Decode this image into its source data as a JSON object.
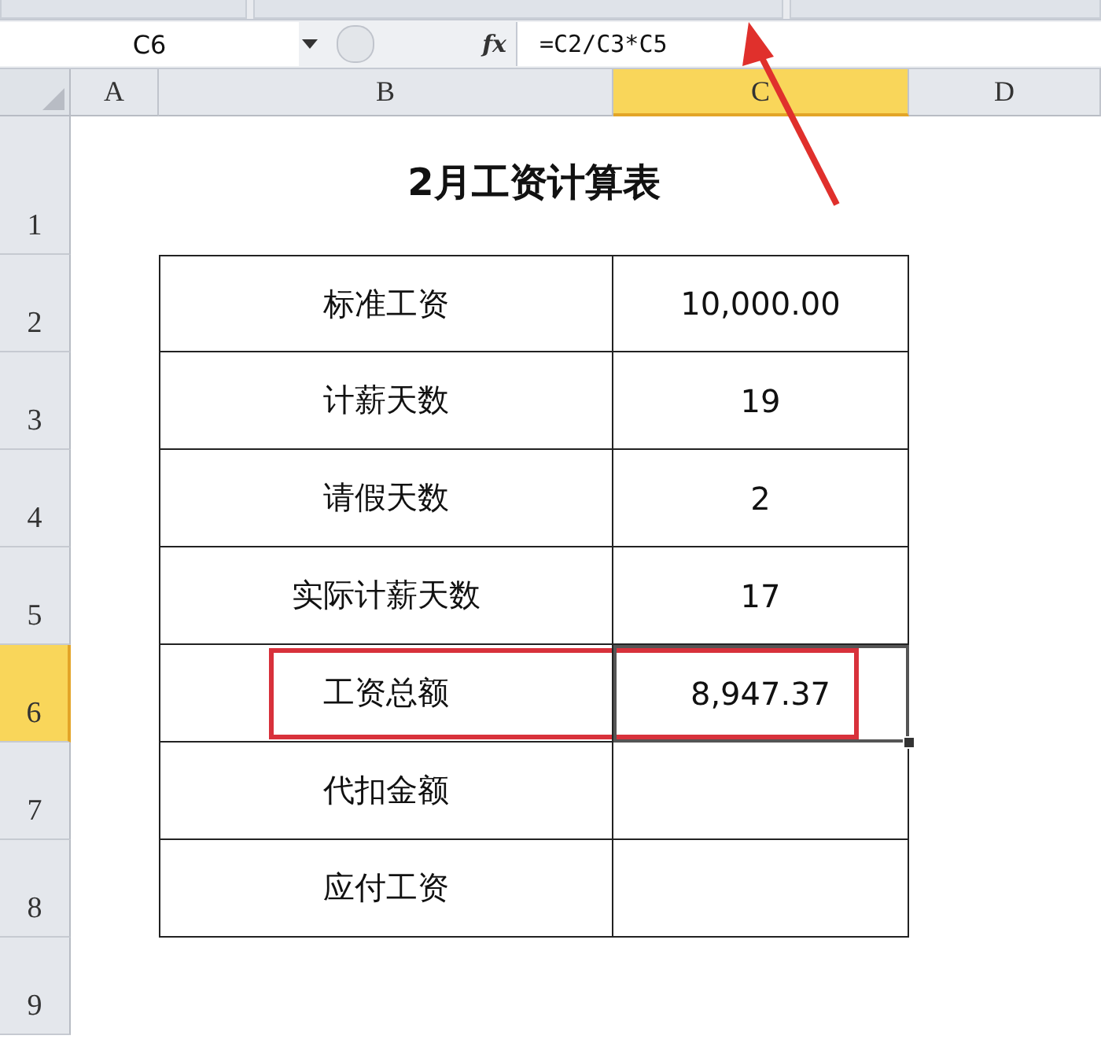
{
  "formula_bar": {
    "name_box": "C6",
    "function_label": "fx",
    "formula": "=C2/C3*C5"
  },
  "columns": [
    {
      "label": "A",
      "selected": false
    },
    {
      "label": "B",
      "selected": false
    },
    {
      "label": "C",
      "selected": true
    },
    {
      "label": "D",
      "selected": false
    }
  ],
  "rows": [
    {
      "number": "1",
      "selected": false,
      "kind": "title",
      "title": "2月工资计算表"
    },
    {
      "number": "2",
      "selected": false,
      "kind": "data",
      "label": "标准工资",
      "value": "10,000.00",
      "active": false,
      "highlighted": false
    },
    {
      "number": "3",
      "selected": false,
      "kind": "data",
      "label": "计薪天数",
      "value": "19",
      "active": false,
      "highlighted": false
    },
    {
      "number": "4",
      "selected": false,
      "kind": "data",
      "label": "请假天数",
      "value": "2",
      "active": false,
      "highlighted": false
    },
    {
      "number": "5",
      "selected": false,
      "kind": "data",
      "label": "实际计薪天数",
      "value": "17",
      "active": false,
      "highlighted": false
    },
    {
      "number": "6",
      "selected": true,
      "kind": "data",
      "label": "工资总额",
      "value": "8,947.37",
      "active": true,
      "highlighted": true
    },
    {
      "number": "7",
      "selected": false,
      "kind": "data",
      "label": "代扣金额",
      "active": false,
      "highlighted": false
    },
    {
      "number": "8",
      "selected": false,
      "kind": "data",
      "label": "应付工资",
      "active": false,
      "highlighted": false
    },
    {
      "number": "9",
      "selected": false,
      "kind": "empty"
    }
  ]
}
